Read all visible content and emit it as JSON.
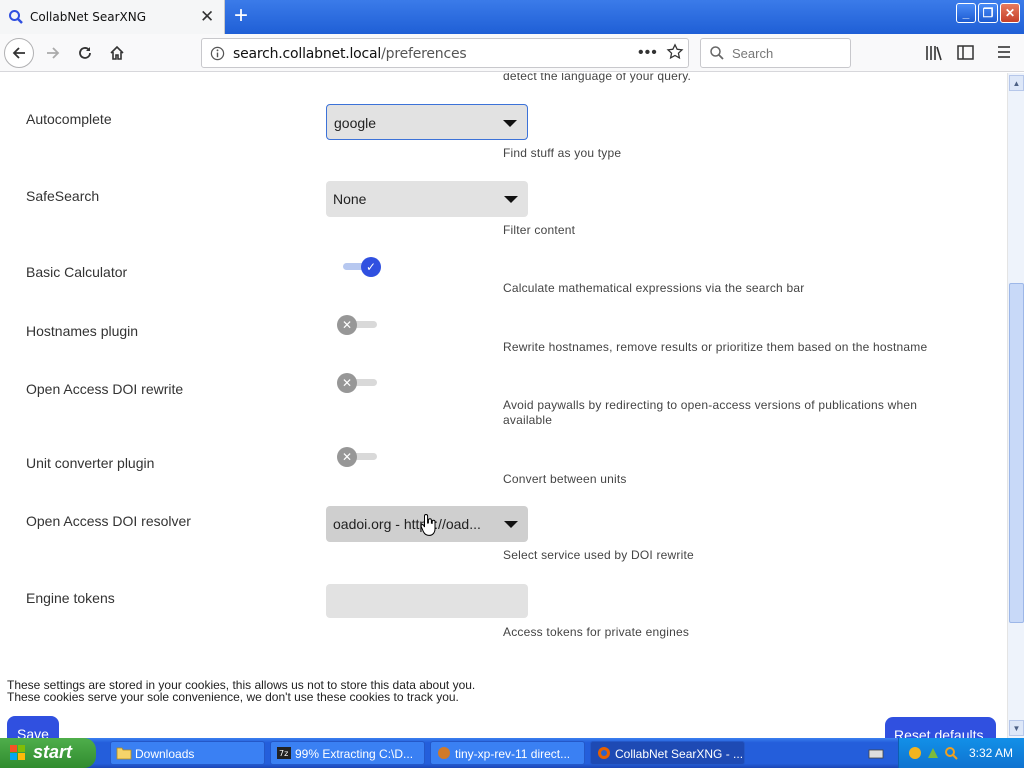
{
  "browser": {
    "tab_title": "CollabNet SearXNG",
    "url_domain": "search.collabnet.local",
    "url_path": "/preferences",
    "search_placeholder": "Search"
  },
  "prefs": {
    "top_partial_desc": "detect the language of your query.",
    "autocomplete": {
      "label": "Autocomplete",
      "value": "google",
      "desc": "Find stuff as you type"
    },
    "safesearch": {
      "label": "SafeSearch",
      "value": "None",
      "desc": "Filter content"
    },
    "calculator": {
      "label": "Basic Calculator",
      "desc": "Calculate mathematical expressions via the search bar",
      "enabled": true
    },
    "hostnames": {
      "label": "Hostnames plugin",
      "desc": "Rewrite hostnames, remove results or prioritize them based on the hostname",
      "enabled": false
    },
    "oa_rewrite": {
      "label": "Open Access DOI rewrite",
      "desc": "Avoid paywalls by redirecting to open-access versions of publications when available",
      "enabled": false
    },
    "unit_converter": {
      "label": "Unit converter plugin",
      "desc": "Convert between units",
      "enabled": false
    },
    "oa_resolver": {
      "label": "Open Access DOI resolver",
      "value": "oadoi.org - https://oad...",
      "desc": "Select service used by DOI rewrite"
    },
    "engine_tokens": {
      "label": "Engine tokens",
      "value": "",
      "desc": "Access tokens for private engines"
    }
  },
  "footer": {
    "note_line1": "These settings are stored in your cookies, this allows us not to store this data about you.",
    "note_line2": "These cookies serve your sole convenience, we don't use these cookies to track you.",
    "save_label": "Save",
    "reset_label": "Reset defaults"
  },
  "taskbar": {
    "start_label": "start",
    "items": [
      {
        "label": "Downloads"
      },
      {
        "label": "99% Extracting C:\\D..."
      },
      {
        "label": "tiny-xp-rev-11 direct..."
      },
      {
        "label": "CollabNet SearXNG - ..."
      }
    ],
    "clock": "3:32 AM"
  },
  "colors": {
    "accent": "#3050e0",
    "taskbar": "#245edb",
    "start": "#3c9a39"
  }
}
